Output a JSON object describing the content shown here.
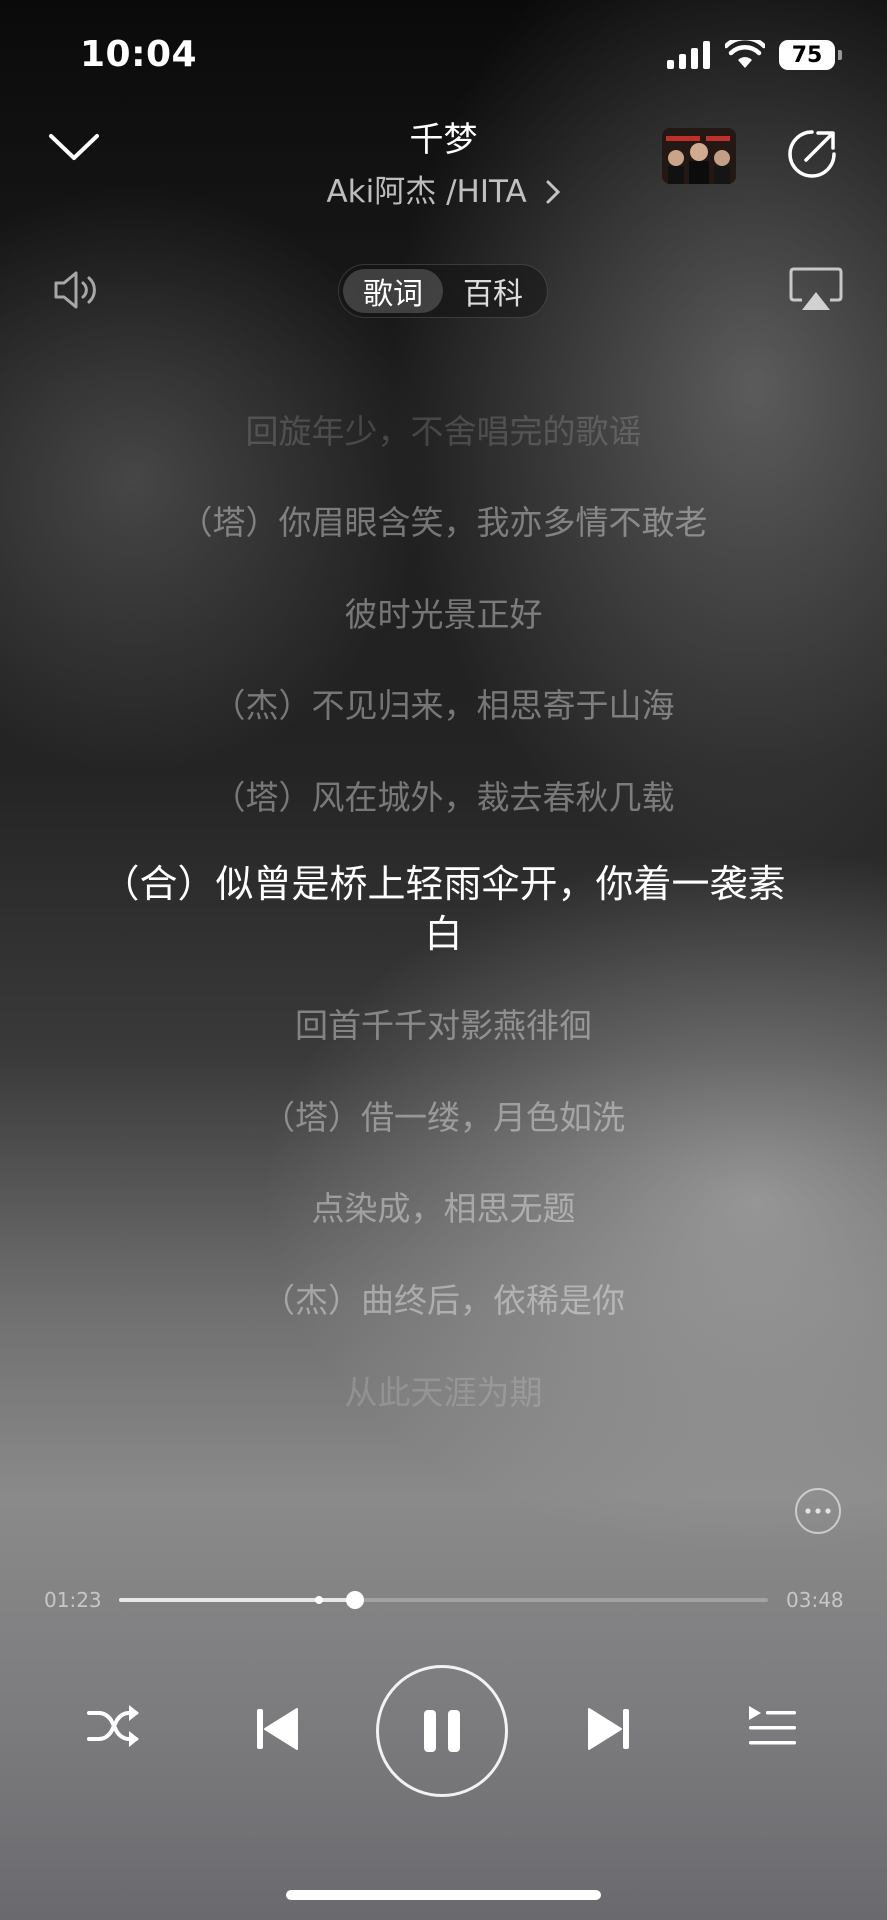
{
  "status_bar": {
    "time": "10:04",
    "battery": "75"
  },
  "header": {
    "title": "千梦",
    "artist": "Aki阿杰 /HITA",
    "collapse_icon": "chevron-down-icon",
    "share_icon": "share-icon"
  },
  "tabs": [
    {
      "label": "歌词",
      "active": true
    },
    {
      "label": "百科",
      "active": false
    }
  ],
  "lyrics": [
    {
      "text": "回旋年少，不舍唱完的歌谣",
      "state": "faint"
    },
    {
      "text": "（塔）你眉眼含笑，我亦多情不敢老",
      "state": "normal"
    },
    {
      "text": "彼时光景正好",
      "state": "normal"
    },
    {
      "text": "（杰）不见归来，相思寄于山海",
      "state": "normal"
    },
    {
      "text": "（塔）风在城外，裁去春秋几载",
      "state": "normal"
    },
    {
      "text_line1": "（合）似曾是桥上轻雨伞开，你着一袭素",
      "text_line2": "白",
      "state": "active"
    },
    {
      "text": "回首千千对影燕徘徊",
      "state": "normal"
    },
    {
      "text": "（塔）借一缕，月色如洗",
      "state": "normal"
    },
    {
      "text": "点染成，相思无题",
      "state": "normal"
    },
    {
      "text": "（杰）曲终后，依稀是你",
      "state": "normal"
    },
    {
      "text": "从此天涯为期",
      "state": "faint"
    }
  ],
  "progress": {
    "current": "01:23",
    "total": "03:48",
    "played_fraction": 0.364,
    "buffer_mark_fraction": 0.308
  },
  "controls": {
    "shuffle": "shuffle-icon",
    "previous": "previous-icon",
    "play_state": "playing",
    "next": "next-icon",
    "playlist": "playlist-icon"
  }
}
